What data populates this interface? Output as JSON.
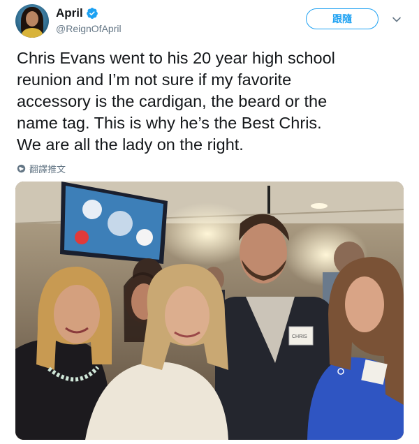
{
  "tweet": {
    "author": {
      "display_name": "April",
      "handle": "@ReignOfApril",
      "verified": true
    },
    "follow_button_label": "跟隨",
    "text": "Chris Evans went to his 20 year high school\nreunion and I’m not sure if my favorite\naccessory is the cardigan, the beard or the\nname tag. This is why he’s the Best Chris.\nWe are all the lady on the right.",
    "translate_label": "翻譯推文",
    "photo": {
      "name_tag_text": "CHRIS"
    }
  },
  "colors": {
    "accent": "#1da1f2",
    "text_primary": "#14171a",
    "text_secondary": "#657786"
  },
  "icons": [
    "verified-icon",
    "chevron-down-icon",
    "globe-icon"
  ]
}
